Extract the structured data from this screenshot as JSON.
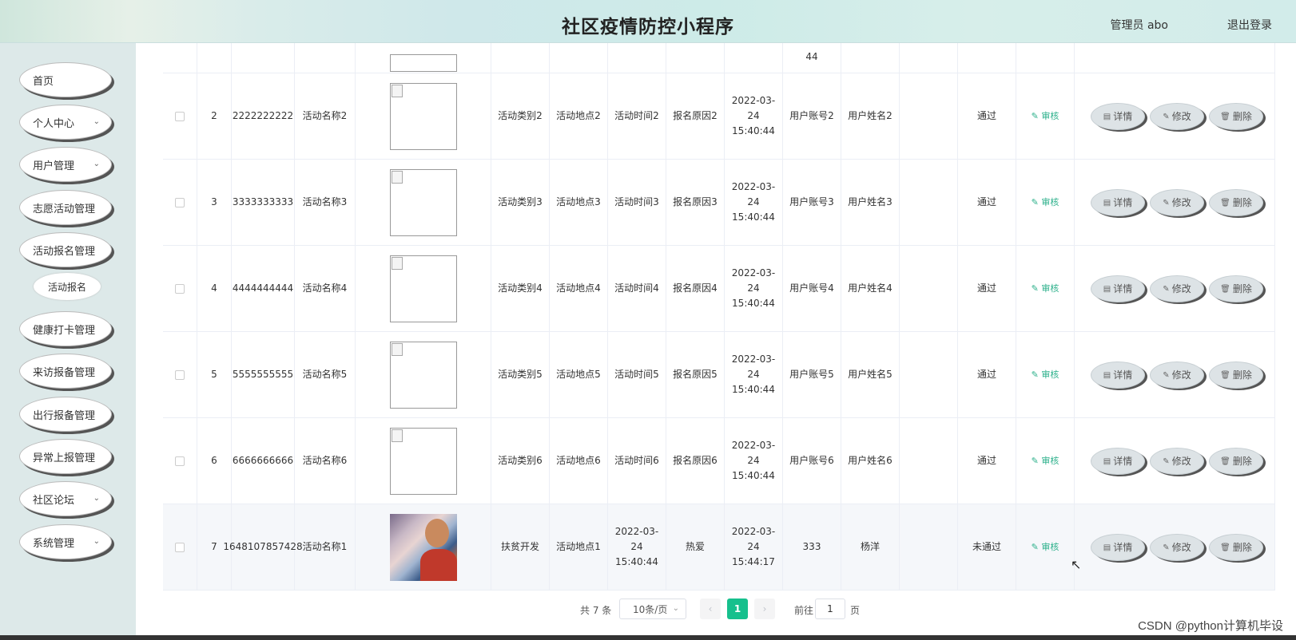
{
  "header": {
    "title": "社区疫情防控小程序",
    "user": "管理员 abo",
    "logout": "退出登录"
  },
  "sidebar": {
    "items": [
      {
        "label": "首页",
        "has_arrow": false
      },
      {
        "label": "个人中心",
        "has_arrow": true
      },
      {
        "label": "用户管理",
        "has_arrow": true
      },
      {
        "label": "志愿活动管理",
        "has_arrow": false
      },
      {
        "label": "活动报名管理",
        "has_arrow": false
      },
      {
        "label": "健康打卡管理",
        "has_arrow": false
      },
      {
        "label": "来访报备管理",
        "has_arrow": false
      },
      {
        "label": "出行报备管理",
        "has_arrow": false
      },
      {
        "label": "异常上报管理",
        "has_arrow": false
      },
      {
        "label": "社区论坛",
        "has_arrow": true
      },
      {
        "label": "系统管理",
        "has_arrow": true
      }
    ],
    "sub_item": "活动报名"
  },
  "table": {
    "partial_top": {
      "time_tail": "44"
    },
    "rows": [
      {
        "idx": "2",
        "number": "2222222222",
        "name": "活动名称2",
        "category": "活动类别2",
        "place": "活动地点2",
        "time": "活动时间2",
        "reason": "报名原因2",
        "signup_time": "2022-03-24 15:40:44",
        "account": "用户账号2",
        "username": "用户姓名2",
        "status": "通过",
        "audit": "审核",
        "photo": false
      },
      {
        "idx": "3",
        "number": "3333333333",
        "name": "活动名称3",
        "category": "活动类别3",
        "place": "活动地点3",
        "time": "活动时间3",
        "reason": "报名原因3",
        "signup_time": "2022-03-24 15:40:44",
        "account": "用户账号3",
        "username": "用户姓名3",
        "status": "通过",
        "audit": "审核",
        "photo": false
      },
      {
        "idx": "4",
        "number": "4444444444",
        "name": "活动名称4",
        "category": "活动类别4",
        "place": "活动地点4",
        "time": "活动时间4",
        "reason": "报名原因4",
        "signup_time": "2022-03-24 15:40:44",
        "account": "用户账号4",
        "username": "用户姓名4",
        "status": "通过",
        "audit": "审核",
        "photo": false
      },
      {
        "idx": "5",
        "number": "5555555555",
        "name": "活动名称5",
        "category": "活动类别5",
        "place": "活动地点5",
        "time": "活动时间5",
        "reason": "报名原因5",
        "signup_time": "2022-03-24 15:40:44",
        "account": "用户账号5",
        "username": "用户姓名5",
        "status": "通过",
        "audit": "审核",
        "photo": false
      },
      {
        "idx": "6",
        "number": "6666666666",
        "name": "活动名称6",
        "category": "活动类别6",
        "place": "活动地点6",
        "time": "活动时间6",
        "reason": "报名原因6",
        "signup_time": "2022-03-24 15:40:44",
        "account": "用户账号6",
        "username": "用户姓名6",
        "status": "通过",
        "audit": "审核",
        "photo": false
      },
      {
        "idx": "7",
        "number": "1648107857428",
        "name": "活动名称1",
        "category": "扶贫开发",
        "place": "活动地点1",
        "time": "2022-03-24 15:40:44",
        "reason": "热爱",
        "signup_time": "2022-03-24 15:44:17",
        "account": "333",
        "username": "杨洋",
        "status": "未通过",
        "audit": "审核",
        "photo": true
      }
    ],
    "actions": {
      "detail": "详情",
      "edit": "修改",
      "delete": "删除"
    }
  },
  "pagination": {
    "total": "共 7 条",
    "page_size": "10条/页",
    "current_page": "1",
    "goto_label": "前往",
    "goto_value": "1",
    "page_label": "页"
  },
  "watermark": "CSDN @python计算机毕设",
  "colors": {
    "accent": "#16c08d",
    "audit": "#2bb08a",
    "sidebar_bg": "#dde9e9"
  }
}
